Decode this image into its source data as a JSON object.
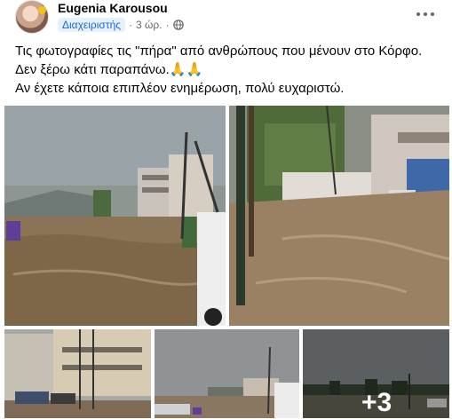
{
  "author": {
    "name": "Eugenia Karousou",
    "role": "Διαχειριστής",
    "time": "3 ώρ."
  },
  "icons": {
    "globe": "globe-icon",
    "more": "more-options-icon"
  },
  "post": {
    "line1": "Τις φωτογραφίες τις \"πήρα\" από ανθρώπους που μένουν στο Κόρφο.",
    "line2": "Δεν ξέρω κάτι παραπάνω.",
    "line2_emoji": "🙏🙏",
    "line3": "Αν έχετε κάποια επιπλέον ενημέρωση, πολύ ευχαριστώ."
  },
  "gallery": {
    "more_count": "+3"
  },
  "colors": {
    "role_bg": "#e7f0fd",
    "role_text": "#1b6ad9",
    "meta": "#65676b"
  }
}
